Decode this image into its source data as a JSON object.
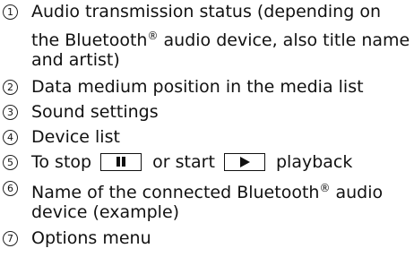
{
  "items": [
    {
      "number": "1",
      "lines": [
        {
          "parts": [
            "Audio transmission status (depending on"
          ]
        },
        {
          "parts": [
            "the Bluetooth",
            "®",
            " audio device, also title name"
          ]
        },
        {
          "parts": [
            "and artist)"
          ]
        }
      ]
    },
    {
      "number": "2",
      "lines": [
        {
          "parts": [
            "Data medium position in the media list"
          ]
        }
      ]
    },
    {
      "number": "3",
      "lines": [
        {
          "parts": [
            "Sound settings"
          ]
        }
      ]
    },
    {
      "number": "4",
      "lines": [
        {
          "parts": [
            "Device list"
          ]
        }
      ]
    },
    {
      "number": "5",
      "lines": [
        {
          "parts": [
            "To stop",
            "or start",
            "playback"
          ],
          "icons": [
            "pause-icon",
            "play-icon"
          ]
        }
      ]
    },
    {
      "number": "6",
      "lines": [
        {
          "parts": [
            "Name of the connected Bluetooth",
            "®",
            " audio"
          ]
        },
        {
          "parts": [
            "device (example)"
          ]
        }
      ]
    },
    {
      "number": "7",
      "lines": [
        {
          "parts": [
            "Options menu"
          ]
        }
      ]
    }
  ]
}
